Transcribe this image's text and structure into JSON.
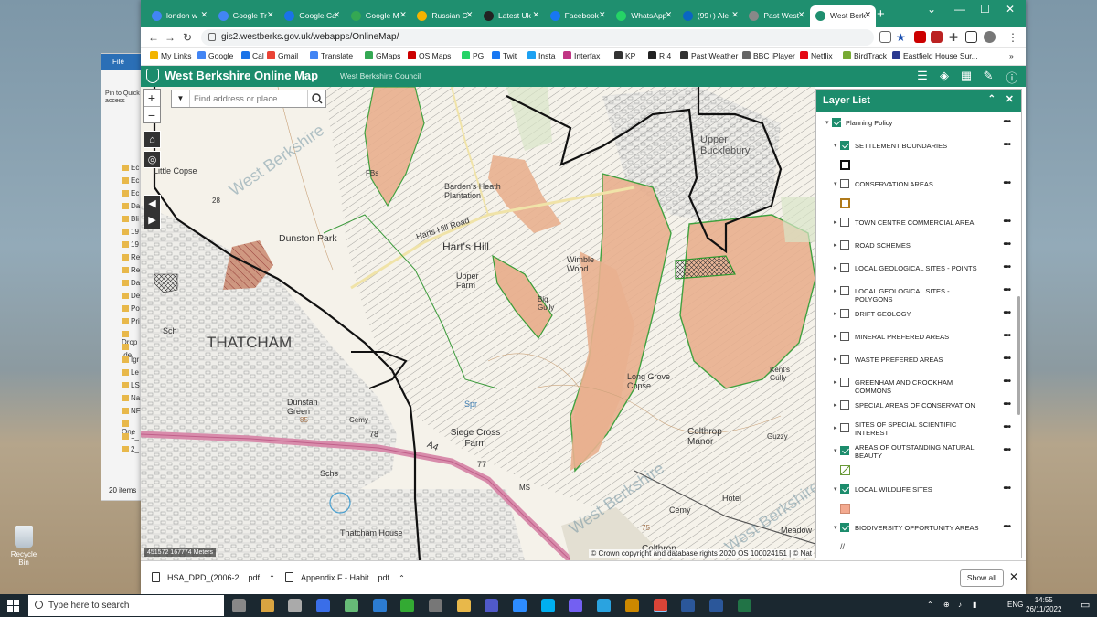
{
  "desktop": {
    "explorer": {
      "ribbon_tab": "File",
      "pin_label": "Pin to Quick access",
      "items": [
        "Ec",
        "Ec",
        "Ec",
        "Da",
        "Bli",
        "19",
        "19",
        "Re",
        "Re",
        "Da",
        "De",
        "Po",
        "Pri",
        "Drop",
        ".de",
        "Igr",
        "Le",
        "LS",
        "Na",
        "NF",
        "One",
        "1_",
        "2_"
      ],
      "count": "20 items"
    },
    "recycle_bin": "Recycle Bin"
  },
  "browser": {
    "tabs": [
      {
        "label": "london w",
        "icon": "google-icon"
      },
      {
        "label": "Google Tr",
        "icon": "translate-icon"
      },
      {
        "label": "Google Ca",
        "icon": "calendar-icon"
      },
      {
        "label": "Google M",
        "icon": "maps-icon"
      },
      {
        "label": "Russian C",
        "icon": "star-icon"
      },
      {
        "label": "Latest Uk",
        "icon": "news-icon"
      },
      {
        "label": "Facebook",
        "icon": "facebook-icon"
      },
      {
        "label": "WhatsApp",
        "icon": "whatsapp-icon"
      },
      {
        "label": "(99+) Ale",
        "icon": "linkedin-icon"
      },
      {
        "label": "Past West",
        "icon": "weather-icon"
      },
      {
        "label": "West Berk",
        "icon": "map-icon",
        "active": true
      }
    ],
    "url": "gis2.westberks.gov.uk/webapps/OnlineMap/",
    "bookmarks": [
      "My Links",
      "Google",
      "Cal",
      "Gmail",
      "Translate",
      "GMaps",
      "OS Maps",
      "PG",
      "Twit",
      "Insta",
      "Interfax",
      "KP",
      "R 4",
      "Past Weather",
      "BBC iPlayer",
      "Netflix",
      "BirdTrack",
      "Eastfield House Sur..."
    ]
  },
  "app": {
    "title": "West Berkshire Online Map",
    "subtitle": "West Berkshire Council",
    "search_placeholder": "Find address or place",
    "scale_readout": "451572 167774 Meters",
    "copyright": "© Crown copyright and database rights 2020 OS 100024151 | © Nat",
    "map_labels": {
      "little_copse": "Little Copse",
      "dunston_park": "Dunston Park",
      "thatcham": "THATCHAM",
      "harts_hill_road": "Harts Hill Road",
      "harts_hill": "Hart's Hill",
      "upper_farm": "Upper Farm",
      "barden_heath": "Barden's Heath Plantation",
      "wimble_wood": "Wimble Wood",
      "big_gully": "Big Gully",
      "long_grove_copse": "Long Grove Copse",
      "dunstan_green": "Dunstan Green",
      "siege_cross_farm": "Siege Cross Farm",
      "colthrop_manor": "Colthrop Manor",
      "a4": "A4",
      "upper_bucklebury": "Upper Bucklebury",
      "thatcham_house": "Thatcham House",
      "kents_gully": "Kent's Gully",
      "colthrop": "Colthrop",
      "meadow": "Meadow",
      "sch": "Sch",
      "schs": "Schs",
      "cemy": "Cemy",
      "ms": "MS",
      "spr": "Spr",
      "n77": "77",
      "n78": "78",
      "n28": "28",
      "n85": "85",
      "n75": "75",
      "fbs": "FBs",
      "hotel": "Hotel",
      "guzzy": "Guzzy",
      "watermark": "West Berkshire"
    },
    "layer_list": {
      "title": "Layer List",
      "group": "Planning Policy",
      "layers": [
        {
          "label": "SETTLEMENT BOUNDARIES",
          "checked": true,
          "expanded": true,
          "swatch": "settlement"
        },
        {
          "label": "CONSERVATION AREAS",
          "checked": false,
          "expanded": true,
          "swatch": "conservation"
        },
        {
          "label": "TOWN CENTRE COMMERCIAL AREA",
          "checked": false
        },
        {
          "label": "ROAD SCHEMES",
          "checked": false
        },
        {
          "label": "LOCAL GEOLOGICAL SITES - POINTS",
          "checked": false
        },
        {
          "label": "LOCAL GEOLOGICAL SITES - POLYGONS",
          "checked": false
        },
        {
          "label": "DRIFT GEOLOGY",
          "checked": false
        },
        {
          "label": "MINERAL PREFERED AREAS",
          "checked": false
        },
        {
          "label": "WASTE PREFERED AREAS",
          "checked": false
        },
        {
          "label": "GREENHAM AND CROOKHAM COMMONS",
          "checked": false
        },
        {
          "label": "SPECIAL AREAS OF CONSERVATION",
          "checked": false
        },
        {
          "label": "SITES OF SPECIAL SCIENTIFIC INTEREST",
          "checked": false
        },
        {
          "label": "AREAS OF OUTSTANDING NATURAL BEAUTY",
          "checked": true,
          "expanded": true,
          "swatch": "aonb"
        },
        {
          "label": "LOCAL WILDLIFE SITES",
          "checked": true,
          "expanded": true,
          "swatch": "wildlife"
        },
        {
          "label": "BIODIVERSITY OPPORTUNITY AREAS",
          "checked": true,
          "expanded": true,
          "swatch": "biodiversity"
        }
      ],
      "swatch_glyph": "//",
      "dots": "•••"
    }
  },
  "downloads": {
    "items": [
      "HSA_DPD_(2006-2....pdf",
      "Appendix F - Habit....pdf"
    ],
    "show_all": "Show all"
  },
  "taskbar": {
    "search_placeholder": "Type here to search",
    "lang": "ENG",
    "time": "14:55",
    "date": "26/11/2022"
  },
  "colors": {
    "accent": "#1c8c6c",
    "wildlife": "#f3a98f",
    "aonb_green": "#3a9a3a",
    "boundary": "#111111"
  }
}
